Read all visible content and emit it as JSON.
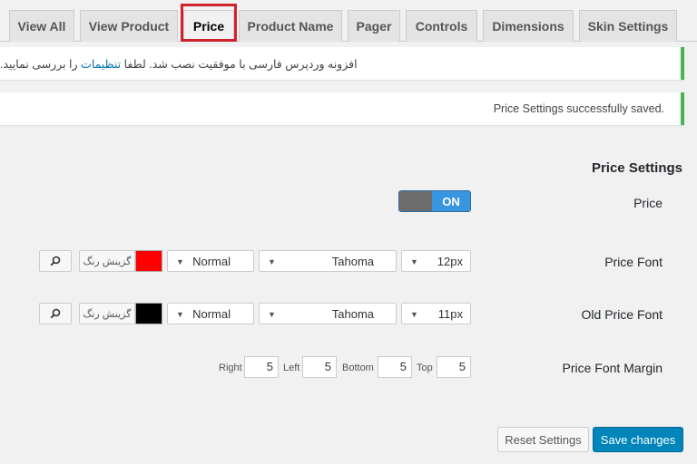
{
  "tabs": [
    {
      "label": "View All"
    },
    {
      "label": "View Product"
    },
    {
      "label": "Price"
    },
    {
      "label": "Product Name"
    },
    {
      "label": "Pager"
    },
    {
      "label": "Controls"
    },
    {
      "label": "Dimensions"
    },
    {
      "label": "Skin Settings"
    }
  ],
  "notices": {
    "plugin_installed_prefix": "افزونه وردپرس فارسی با موفقیت نصب شد. لطفا",
    "plugin_installed_link": "تنظیمات",
    "plugin_installed_suffix": "را بررسی نمایید.",
    "saved": "Price Settings successfully saved."
  },
  "settings": {
    "title": "Price Settings",
    "price": {
      "label": "Price",
      "toggle": "ON"
    },
    "price_font": {
      "label": "Price Font",
      "size": "12px",
      "family": "Tahoma",
      "weight": "Normal",
      "color": "#ff0000",
      "color_button": "گزینش رنگ"
    },
    "old_price_font": {
      "label": "Old Price Font",
      "size": "11px",
      "family": "Tahoma",
      "weight": "Normal",
      "color": "#000000",
      "color_button": "گزینش رنگ"
    },
    "margin": {
      "label": "Price Font Margin",
      "top_label": "Top",
      "top": "5",
      "bottom_label": "Bottom",
      "bottom": "5",
      "left_label": "Left",
      "left": "5",
      "right_label": "Right",
      "right": "5"
    }
  },
  "actions": {
    "reset": "Reset Settings",
    "save": "Save changes"
  },
  "colors": {
    "accent": "#0085ba",
    "success": "#46b450",
    "toggle_on": "#3895e0",
    "highlight": "#d0222b"
  }
}
